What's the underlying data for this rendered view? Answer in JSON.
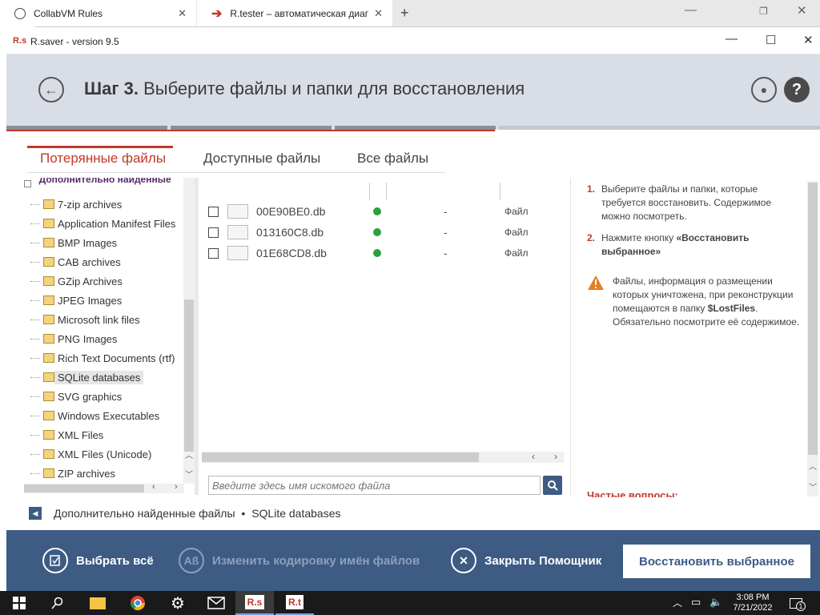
{
  "browser": {
    "tabs": [
      {
        "title": "CollabVM Rules"
      },
      {
        "title": "R.tester – автоматическая диаг"
      }
    ],
    "new_tab": "+",
    "window_controls": [
      "—",
      "❐",
      "✕"
    ]
  },
  "app": {
    "logo": "R.s",
    "title": "R.saver - version 9.5",
    "window_controls": [
      "—",
      "☐",
      "✕"
    ]
  },
  "header": {
    "step": "Шаг 3.",
    "title": "Выберите файлы и папки для восстановления"
  },
  "tabs": [
    {
      "label": "Потерянные файлы",
      "active": true
    },
    {
      "label": "Доступные файлы",
      "active": false
    },
    {
      "label": "Все файлы",
      "active": false
    }
  ],
  "tree": {
    "root_label": "Дополнительно найденные",
    "items": [
      {
        "label": "7-zip archives"
      },
      {
        "label": "Application Manifest Files"
      },
      {
        "label": "BMP Images"
      },
      {
        "label": "CAB archives"
      },
      {
        "label": "GZip Archives"
      },
      {
        "label": "JPEG Images"
      },
      {
        "label": "Microsoft link files"
      },
      {
        "label": "PNG Images"
      },
      {
        "label": "Rich Text Documents (rtf)"
      },
      {
        "label": "SQLite databases",
        "selected": true
      },
      {
        "label": "SVG graphics"
      },
      {
        "label": "Windows Executables"
      },
      {
        "label": "XML Files"
      },
      {
        "label": "XML Files (Unicode)"
      },
      {
        "label": "ZIP archives"
      }
    ]
  },
  "files": [
    {
      "name": "00E90BE0.db",
      "size": "-",
      "type": "Файл"
    },
    {
      "name": "013160C8.db",
      "size": "-",
      "type": "Файл"
    },
    {
      "name": "01E68CD8.db",
      "size": "-",
      "type": "Файл"
    }
  ],
  "search": {
    "placeholder": "Введите здесь имя искомого файла"
  },
  "help": {
    "step1_num": "1.",
    "step1_text": "Выберите файлы и папки, которые требуется восстановить. Содержимое можно посмотреть.",
    "step2_num": "2.",
    "step2_text": "Нажмите кнопку",
    "step2_bold": "«Восстановить выбранное»",
    "warn_text1": "Файлы, информация о размещении которых уничтожена, при реконструкции помещаются в папку",
    "warn_bold": "$LostFiles",
    "warn_text2": ". Обязательно посмотрите её содержимое.",
    "faq": "Частые вопросы:"
  },
  "breadcrumb": {
    "part1": "Дополнительно найденные файлы",
    "sep": "•",
    "part2": "SQLite databases"
  },
  "toolbar": {
    "select_all": "Выбрать всё",
    "encoding": "Изменить кодировку имён файлов",
    "encoding_icon": "Aß",
    "close_helper": "Закрыть Помощник",
    "restore": "Восстановить выбранное"
  },
  "taskbar": {
    "time": "3:08 PM",
    "date": "7/21/2022",
    "notif_count": "1",
    "rs_label": "R.s",
    "rt_label": "R.t"
  },
  "colors": {
    "accent_red": "#c0392b",
    "toolbar_blue": "#3d5b83",
    "header_gray": "#d9dde6"
  }
}
